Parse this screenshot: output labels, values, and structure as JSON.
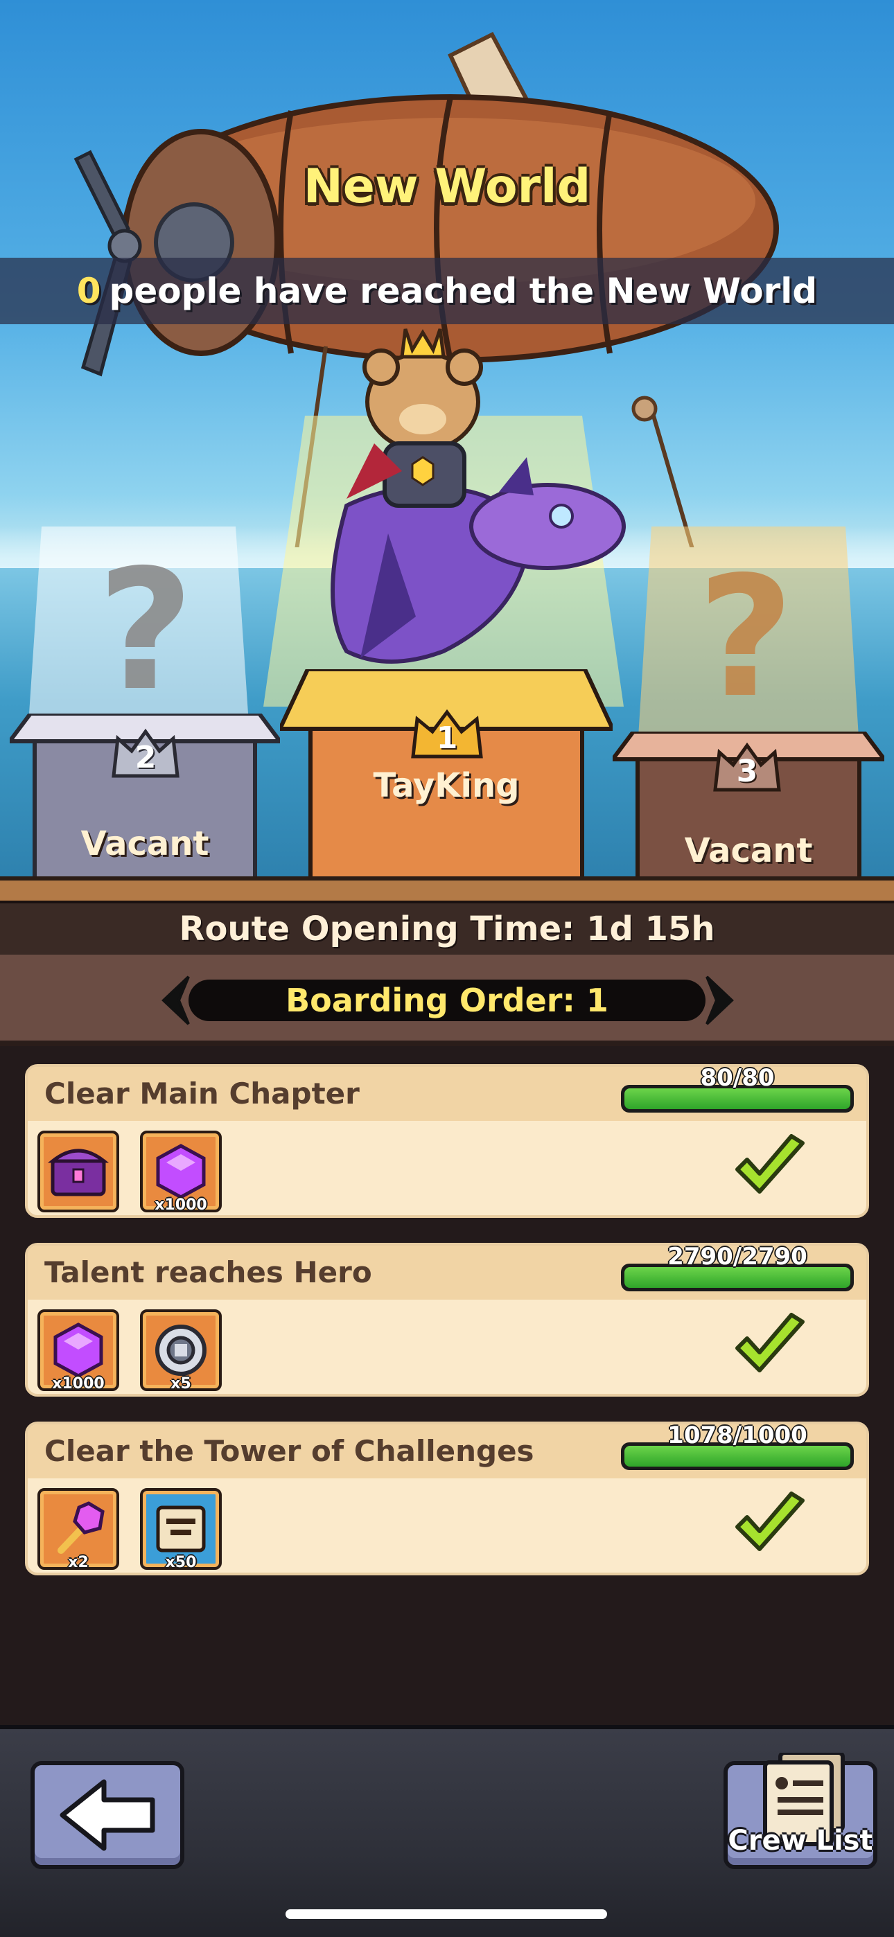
{
  "header": {
    "title": "New World",
    "reached_count": "0",
    "reached_text": "people have reached the New World"
  },
  "podiums": [
    {
      "rank": "2",
      "name": "Vacant",
      "occupied": false
    },
    {
      "rank": "1",
      "name": "TayKing",
      "occupied": true
    },
    {
      "rank": "3",
      "name": "Vacant",
      "occupied": false
    }
  ],
  "unknown_glyph": "?",
  "route": {
    "text": "Route Opening Time: 1d 15h"
  },
  "boarding": {
    "text": "Boarding Order: 1"
  },
  "tasks": [
    {
      "title": "Clear Main Chapter",
      "progress_text": "80/80",
      "progress": 1.0,
      "completed": true,
      "rewards": [
        {
          "icon": "treasure-chest-icon",
          "qty": ""
        },
        {
          "icon": "purple-gem-icon",
          "qty": "x1000"
        }
      ]
    },
    {
      "title": "Talent reaches Hero",
      "progress_text": "2790/2790",
      "progress": 1.0,
      "completed": true,
      "rewards": [
        {
          "icon": "purple-gem-icon",
          "qty": "x1000"
        },
        {
          "icon": "silver-coin-icon",
          "qty": "x5"
        }
      ]
    },
    {
      "title": "Clear the Tower of Challenges",
      "progress_text": "1078/1000",
      "progress": 1.0,
      "completed": true,
      "rewards": [
        {
          "icon": "magic-scepter-icon",
          "qty": "x2"
        },
        {
          "icon": "scroll-icon",
          "qty": "x50"
        }
      ]
    }
  ],
  "footer": {
    "back_icon": "back-arrow-icon",
    "crew_label": "Crew List"
  },
  "colors": {
    "title_yellow": "#fff27a",
    "accent_yellow": "#ffe86c",
    "progress_green": "#2fa52a",
    "card_bg": "#fbeacb",
    "check_green": "#a6e22e"
  }
}
